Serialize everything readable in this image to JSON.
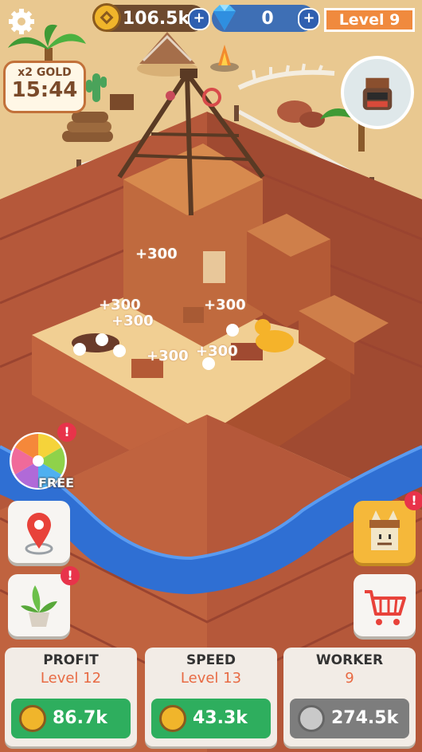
{
  "top_bar": {
    "coins": "106.5k",
    "gems": "0",
    "level": "Level 9",
    "coin_plus": "+",
    "gem_plus": "+"
  },
  "boost": {
    "multiplier": "x2 GOLD",
    "timer": "15:44"
  },
  "floating_rewards": [
    "+300",
    "+300",
    "+300",
    "+300",
    "+300",
    "+300"
  ],
  "wheel": {
    "label": "FREE",
    "badge": "!"
  },
  "side_badges": {
    "plant": "!",
    "worker": "!"
  },
  "upgrades": [
    {
      "title": "PROFIT",
      "level": "Level 12",
      "cost": "86.7k"
    },
    {
      "title": "SPEED",
      "level": "Level 13",
      "cost": "43.3k"
    },
    {
      "title": "WORKER",
      "level": "9",
      "cost": "274.5k"
    }
  ],
  "colors": {
    "sand": "#e9c890",
    "dirt": "#b5583a",
    "water": "#2f6fd3",
    "accent_orange": "#f08a3e",
    "buy_green": "#2eae5e"
  },
  "icons": [
    "gear-icon",
    "coin-icon",
    "diamond-icon",
    "map-pin-icon",
    "plant-icon",
    "cart-icon",
    "worker-icon",
    "wheel-icon"
  ]
}
